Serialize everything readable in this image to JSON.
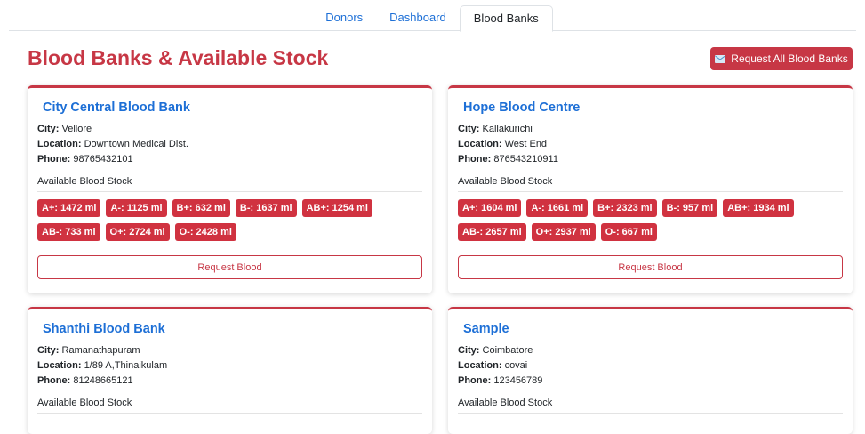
{
  "nav": {
    "tabs": [
      {
        "label": "Donors"
      },
      {
        "label": "Dashboard"
      },
      {
        "label": "Blood Banks"
      }
    ]
  },
  "header": {
    "title": "Blood Banks & Available Stock",
    "request_all_label": "Request All Blood Banks"
  },
  "labels": {
    "city": "City:",
    "location": "Location:",
    "phone": "Phone:",
    "stock_title": "Available Blood Stock",
    "request_button": "Request Blood"
  },
  "banks": [
    {
      "name": "City Central Blood Bank",
      "city": "Vellore",
      "location": "Downtown Medical Dist.",
      "phone": "98765432101",
      "stock": [
        "A+: 1472 ml",
        "A-: 1125 ml",
        "B+: 632 ml",
        "B-: 1637 ml",
        "AB+: 1254 ml",
        "AB-: 733 ml",
        "O+: 2724 ml",
        "O-: 2428 ml"
      ]
    },
    {
      "name": "Hope Blood Centre",
      "city": "Kallakurichi",
      "location": "West End",
      "phone": "876543210911",
      "stock": [
        "A+: 1604 ml",
        "A-: 1661 ml",
        "B+: 2323 ml",
        "B-: 957 ml",
        "AB+: 1934 ml",
        "AB-: 2657 ml",
        "O+: 2937 ml",
        "O-: 667 ml"
      ]
    },
    {
      "name": "Shanthi Blood Bank",
      "city": "Ramanathapuram",
      "location": "1/89 A,Thinaikulam",
      "phone": "81248665121"
    },
    {
      "name": "Sample",
      "city": "Coimbatore",
      "location": "covai",
      "phone": "123456789"
    }
  ]
}
